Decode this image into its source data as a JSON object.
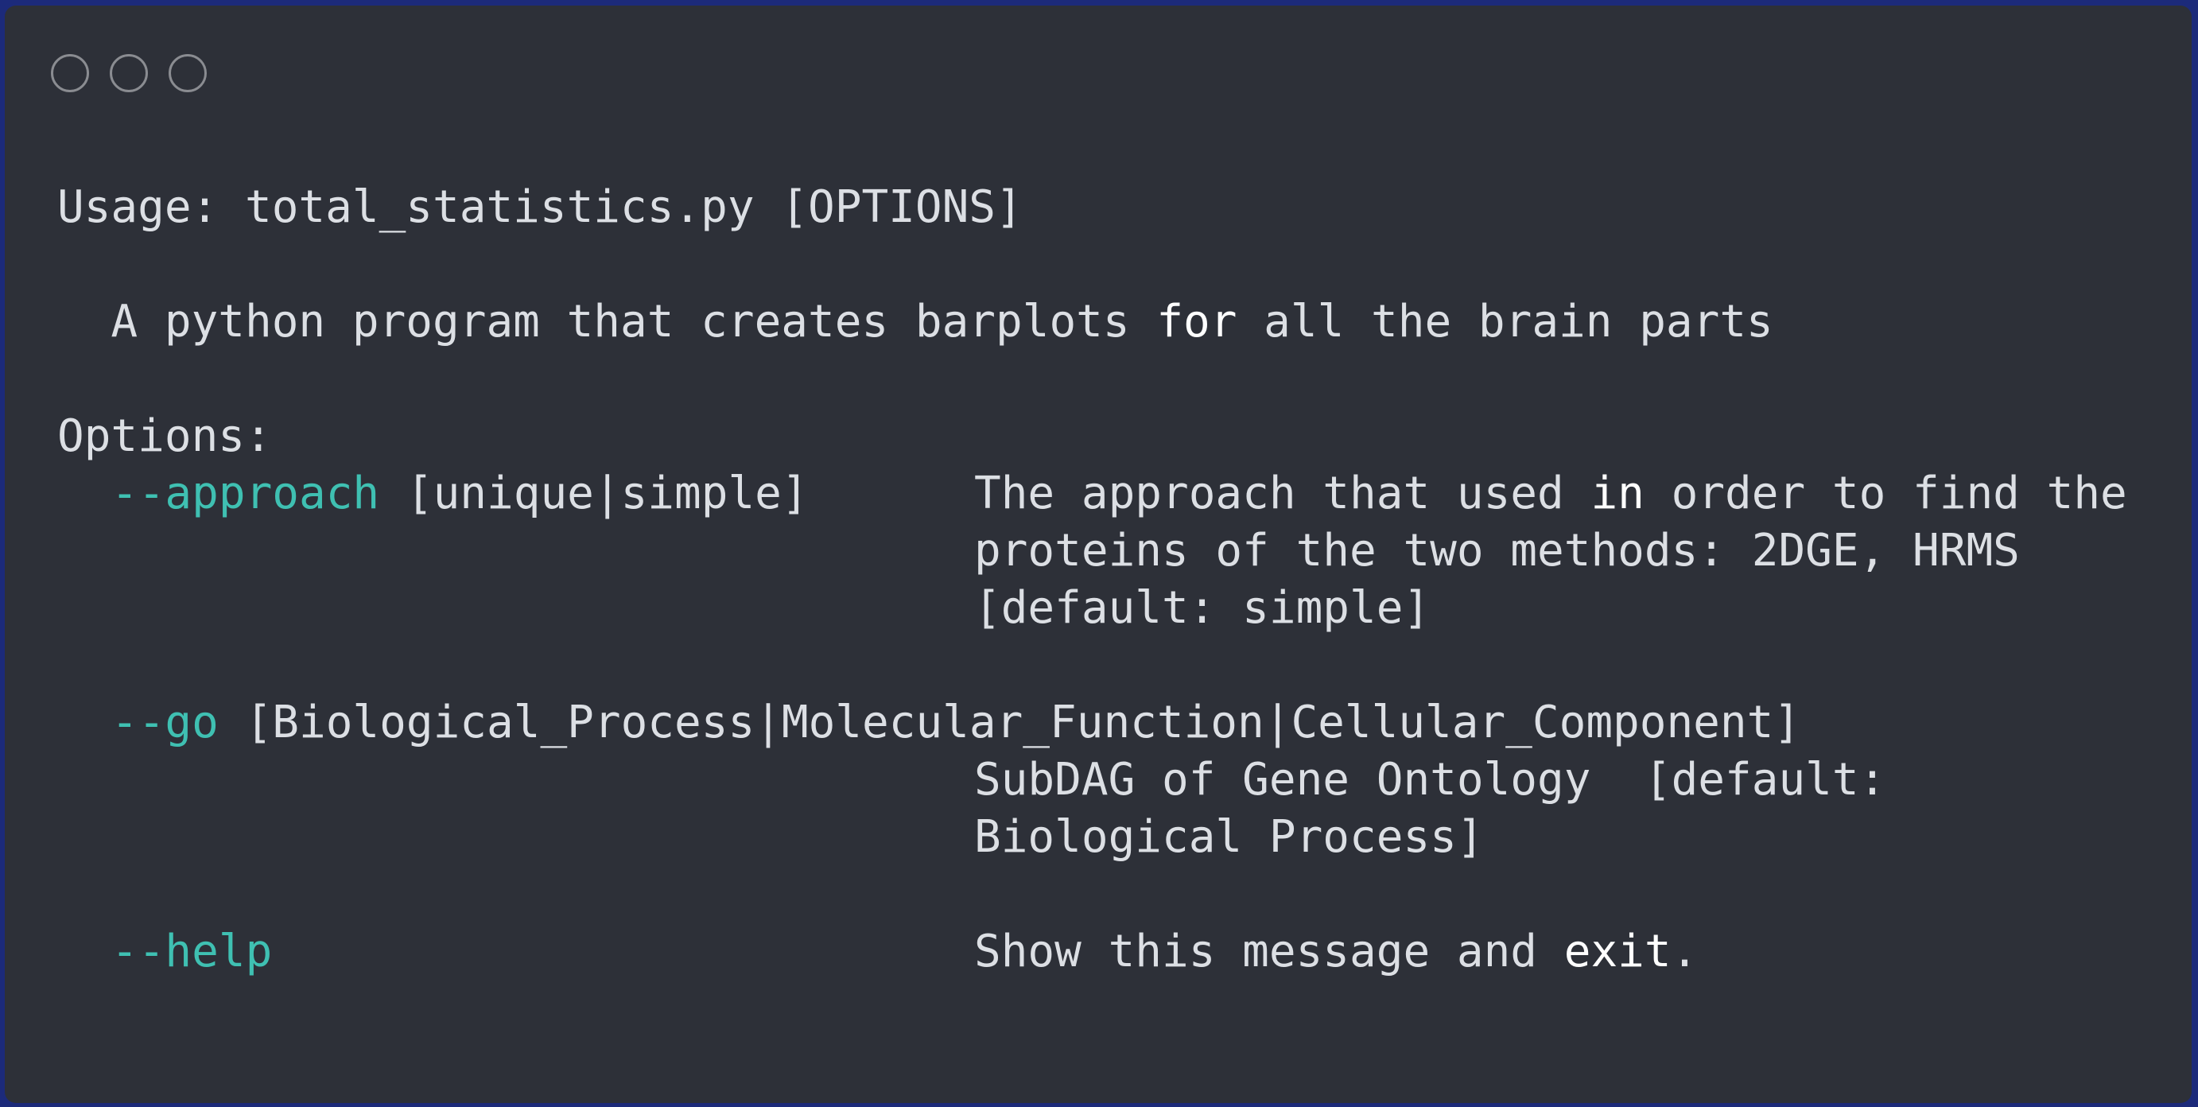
{
  "window": {
    "controls": [
      "close-dot",
      "minimize-dot",
      "maximize-dot"
    ],
    "accent_color": "#3fc0b2",
    "background": "#2d3038"
  },
  "usage": "Usage: total_statistics.py [OPTIONS]",
  "description": {
    "before": "  A python program that creates barplots ",
    "keyword": "for",
    "after": " all the brain parts"
  },
  "options_header": "Options:",
  "options": {
    "approach": {
      "flag": "--approach",
      "choices": " [unique|simple]",
      "desc1_a": "The approach that used ",
      "desc1_kw": "in",
      "desc1_b": " order to find the",
      "desc2": "proteins of the two methods: 2DGE, HRMS",
      "desc3": "[default: simple]"
    },
    "go": {
      "flag": "--go",
      "choices": " [Biological_Process|Molecular_Function|Cellular_Component]",
      "desc1": "SubDAG of Gene Ontology  [default:",
      "desc2": "Biological Process]"
    },
    "help": {
      "flag": "--help",
      "desc_a": "Show this message and ",
      "desc_kw": "exit",
      "desc_b": "."
    }
  }
}
